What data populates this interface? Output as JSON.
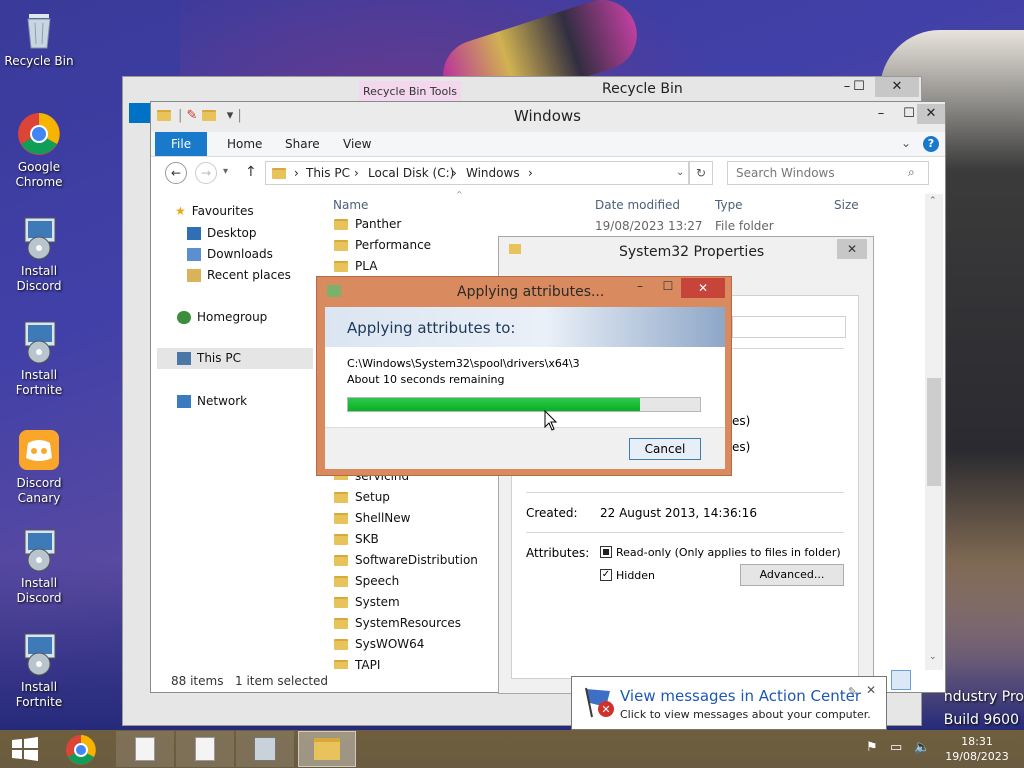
{
  "desktop": {
    "icons": [
      {
        "label": "Recycle Bin"
      },
      {
        "label": "Google Chrome"
      },
      {
        "label": "Install Discord"
      },
      {
        "label": "Install Fortnite"
      },
      {
        "label": "Discord Canary"
      },
      {
        "label": "Install Discord"
      },
      {
        "label": "Install Fortnite"
      }
    ],
    "watermark_line1": "ndustry Pro",
    "watermark_line2": "Build 9600"
  },
  "recycle_window": {
    "title": "Recycle Bin",
    "tools_tab": "Recycle Bin Tools"
  },
  "explorer": {
    "title": "Windows",
    "ribbon_tabs": [
      "File",
      "Home",
      "Share",
      "View"
    ],
    "breadcrumb": [
      "This PC",
      "Local Disk (C:)",
      "Windows"
    ],
    "search_placeholder": "Search Windows",
    "columns": [
      "Name",
      "Date modified",
      "Type",
      "Size"
    ],
    "sidebar": {
      "favourites": "Favourites",
      "items": [
        "Desktop",
        "Downloads",
        "Recent places"
      ],
      "homegroup": "Homegroup",
      "thispc": "This PC",
      "network": "Network"
    },
    "files": [
      {
        "name": "Panther",
        "date": "19/08/2023 13:27",
        "type": "File folder"
      },
      {
        "name": "Performance"
      },
      {
        "name": "PLA"
      },
      {
        "name": "servicing"
      },
      {
        "name": "Setup"
      },
      {
        "name": "ShellNew"
      },
      {
        "name": "SKB"
      },
      {
        "name": "SoftwareDistribution"
      },
      {
        "name": "Speech"
      },
      {
        "name": "System"
      },
      {
        "name": "SystemResources"
      },
      {
        "name": "SysWOW64"
      },
      {
        "name": "TAPI"
      }
    ],
    "status_items": "88 items",
    "status_selected": "1 item selected"
  },
  "properties": {
    "title": "System32 Properties",
    "partial1": "es)",
    "partial2": "es)",
    "created_label": "Created:",
    "created_value": "22 August 2013, 14:36:16",
    "attributes_label": "Attributes:",
    "readonly_label": "Read-only (Only applies to files in folder)",
    "hidden_label": "Hidden",
    "advanced_button": "Advanced..."
  },
  "apply_dialog": {
    "title": "Applying attributes...",
    "heading": "Applying attributes to:",
    "path": "C:\\Windows\\System32\\spool\\drivers\\x64\\3",
    "remaining": "About 10 seconds remaining",
    "progress": 0.83,
    "cancel": "Cancel"
  },
  "notification": {
    "title": "View messages in Action Center",
    "body": "Click to view messages about your computer."
  },
  "clock": {
    "time": "18:31",
    "date": "19/08/2023"
  },
  "colors": {
    "accent": "#0072c6",
    "progress": "#06b025",
    "dialog_border": "#d98b5f"
  }
}
